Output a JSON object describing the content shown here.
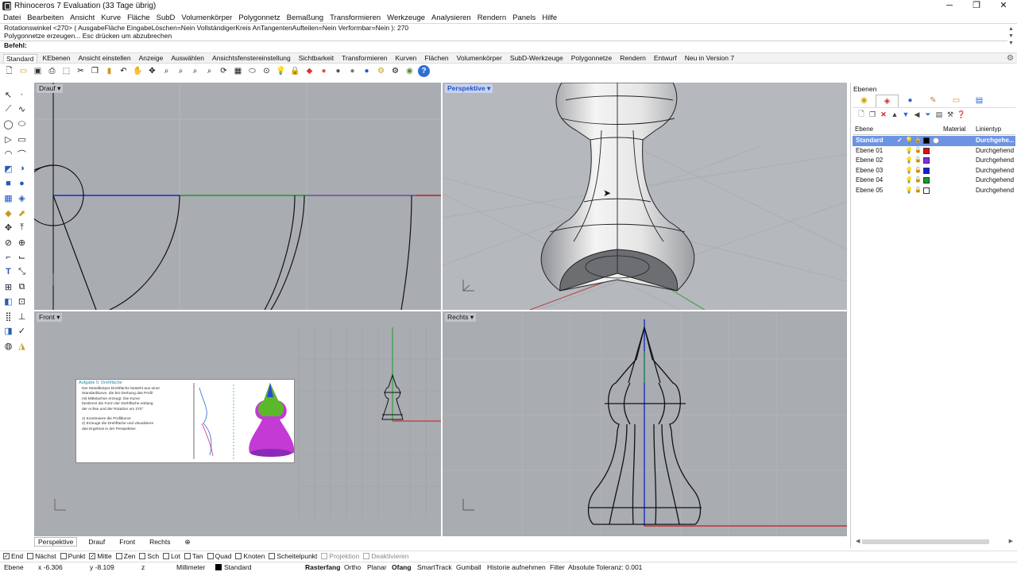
{
  "window": {
    "title": "Rhinoceros 7 Evaluation (33 Tage übrig)",
    "minimize": "─",
    "maximize": "❐",
    "close": "✕"
  },
  "menu": [
    "Datei",
    "Bearbeiten",
    "Ansicht",
    "Kurve",
    "Fläche",
    "SubD",
    "Volumenkörper",
    "Polygonnetz",
    "Bemaßung",
    "Transformieren",
    "Werkzeuge",
    "Analysieren",
    "Rendern",
    "Panels",
    "Hilfe"
  ],
  "command": {
    "history_1": "Rotationswinkel <270> ( AusgabeFläche EingabeLöschen=Nein VollständigerKreis AnTangentenAufteilen=Nein Verformbar=Nein ): 270",
    "history_2": "Polygonnetze erzeugen... Esc drücken um abzubrechen",
    "prompt": "Befehl:"
  },
  "toolbar_tabs": [
    "Standard",
    "KEbenen",
    "Ansicht einstellen",
    "Anzeige",
    "Auswählen",
    "Ansichtsfenstereinstellung",
    "Sichtbarkeit",
    "Transformieren",
    "Kurven",
    "Flächen",
    "Volumenkörper",
    "SubD-Werkzeuge",
    "Polygonnetze",
    "Rendern",
    "Entwurf",
    "Neu in Version 7"
  ],
  "active_toolbar_tab": "Standard",
  "toolbar_icons": [
    "new-file-icon",
    "open-file-icon",
    "save-icon",
    "print-icon",
    "import-icon",
    "cut-icon",
    "copy-icon",
    "paste-icon",
    "undo-icon",
    "pan-icon",
    "rotate-view-icon",
    "zoom-icon",
    "zoom-window-icon",
    "zoom-extents-icon",
    "zoom-selected-icon",
    "rotate-icon",
    "grid-icon",
    "named-view-icon",
    "select-points-icon",
    "light-icon",
    "lock-icon",
    "color-wheel-icon",
    "render-sphere-icon",
    "material-sphere-icon",
    "globe-icon",
    "cplane-icon",
    "settings-icon",
    "properties-icon",
    "render-icon",
    "help-icon"
  ],
  "viewports": {
    "top": {
      "label": "Drauf"
    },
    "perspective": {
      "label": "Perspektive"
    },
    "front": {
      "label": "Front"
    },
    "right": {
      "label": "Rechts"
    }
  },
  "viewport_tabs": [
    "Perspektive",
    "Drauf",
    "Front",
    "Rechts"
  ],
  "active_viewport_tab": "Perspektive",
  "osnaps": [
    {
      "label": "End",
      "checked": true,
      "enabled": true
    },
    {
      "label": "Nächst",
      "checked": false,
      "enabled": true
    },
    {
      "label": "Punkt",
      "checked": false,
      "enabled": true
    },
    {
      "label": "Mitte",
      "checked": true,
      "enabled": true
    },
    {
      "label": "Zen",
      "checked": false,
      "enabled": true
    },
    {
      "label": "Sch",
      "checked": false,
      "enabled": true
    },
    {
      "label": "Lot",
      "checked": false,
      "enabled": true
    },
    {
      "label": "Tan",
      "checked": false,
      "enabled": true
    },
    {
      "label": "Quad",
      "checked": false,
      "enabled": true
    },
    {
      "label": "Knoten",
      "checked": false,
      "enabled": true
    },
    {
      "label": "Scheitelpunkt",
      "checked": false,
      "enabled": true
    },
    {
      "label": "Projektion",
      "checked": false,
      "enabled": false
    },
    {
      "label": "Deaktivieren",
      "checked": false,
      "enabled": false
    }
  ],
  "status": {
    "cplane": "Ebene",
    "x": "x -6.306",
    "y": "y -8.109",
    "z": "z",
    "units": "Millimeter",
    "layer": "Standard",
    "grid_snap": "Rasterfang",
    "ortho": "Ortho",
    "planar": "Planar",
    "osnap": "Ofang",
    "smarttrack": "SmartTrack",
    "gumball": "Gumball",
    "history": "Historie aufnehmen",
    "filter": "Filter",
    "tolerance": "Absolute Toleranz: 0.001"
  },
  "layers_panel": {
    "title": "Ebenen",
    "col_layer": "Ebene",
    "col_material": "Material",
    "col_linetype": "Linientyp",
    "rows": [
      {
        "name": "Standard",
        "color": "#000000",
        "linetype": "Durchgehe...",
        "current": true,
        "check": "✓"
      },
      {
        "name": "Ebene 01",
        "color": "#e01010",
        "linetype": "Durchgehend",
        "current": false,
        "check": ""
      },
      {
        "name": "Ebene 02",
        "color": "#8a2be2",
        "linetype": "Durchgehend",
        "current": false,
        "check": ""
      },
      {
        "name": "Ebene 03",
        "color": "#1020e0",
        "linetype": "Durchgehend",
        "current": false,
        "check": ""
      },
      {
        "name": "Ebene 04",
        "color": "#14a020",
        "linetype": "Durchgehend",
        "current": false,
        "check": ""
      },
      {
        "name": "Ebene 05",
        "color": "#ffffff",
        "linetype": "Durchgehend",
        "current": false,
        "check": ""
      }
    ]
  },
  "reference_image": {
    "heading": "Aufgabe 5: Drehfläche",
    "body": [
      "Der Metallkörper Drehfläche besteht aus einer",
      "Standardkurve, die bei Drehung das Profil",
      "mit Mittelachse erzeugt. Die Kurve",
      "bestimmt die Form der Drehfläche entlang",
      "der Achse und der Rotation um 270°."
    ],
    "tasks": [
      "1) Konstruiere die Profilkurve",
      "2) Erzeuge die Drehfläche und visualisiere",
      "   das Ergebnis in der Perspektive"
    ]
  }
}
